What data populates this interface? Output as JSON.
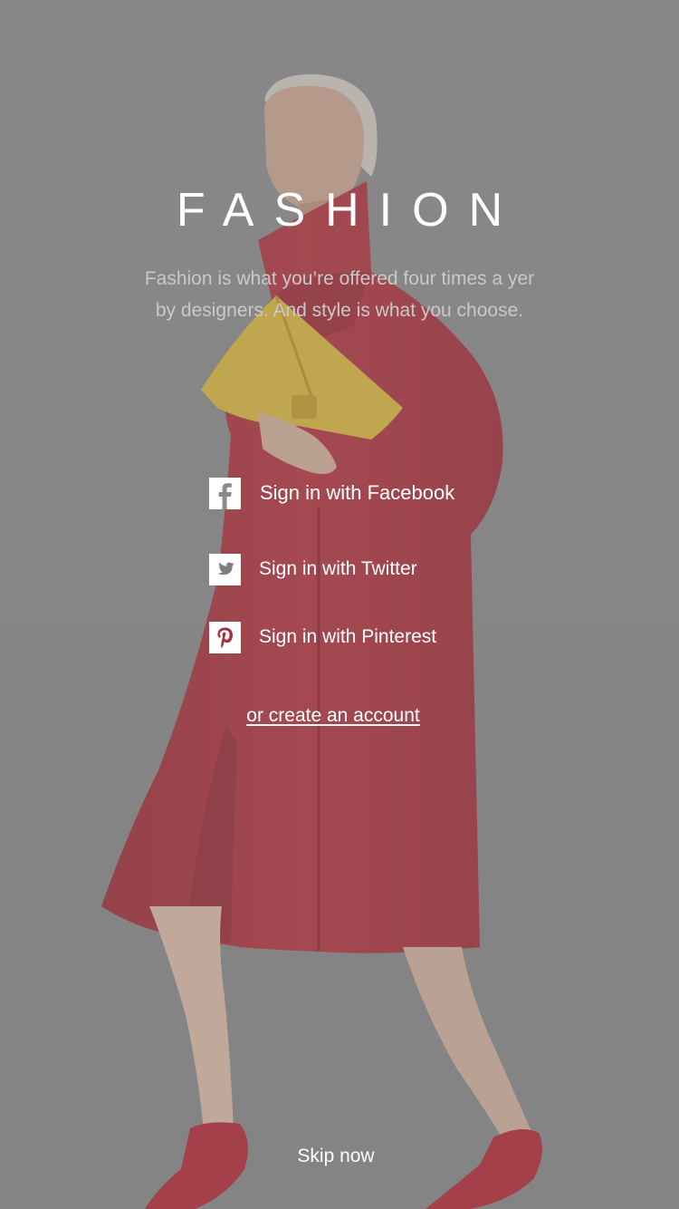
{
  "app": {
    "title": "FASHION",
    "tagline_line1": "Fashion is what you’re offered four times a yer",
    "tagline_line2": "by designers. And style is what you choose."
  },
  "signin": {
    "facebook_label": "Sign in with Facebook",
    "twitter_label": "Sign in with Twitter",
    "pinterest_label": "Sign in with Pinterest"
  },
  "links": {
    "create_account": "or create an account",
    "skip": "Skip now"
  },
  "icons": {
    "facebook": "facebook-icon",
    "twitter": "twitter-icon",
    "pinterest": "pinterest-icon"
  },
  "colors": {
    "overlay": "#858585",
    "coat": "#b0303c",
    "clutch": "#d8b53a",
    "facebook_glyph": "#8a8a8a",
    "twitter_glyph": "#7d7d7d",
    "pinterest_glyph": "#a23040"
  }
}
